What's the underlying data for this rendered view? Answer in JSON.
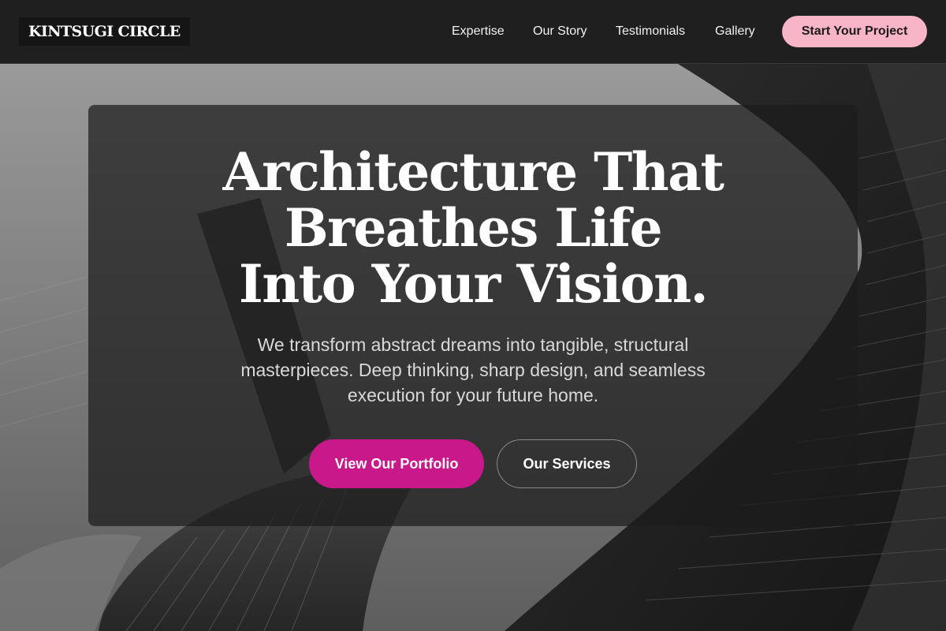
{
  "header": {
    "logo": "KINTSUGI CIRCLE",
    "nav": [
      {
        "label": "Expertise"
      },
      {
        "label": "Our Story"
      },
      {
        "label": "Testimonials"
      },
      {
        "label": "Gallery"
      }
    ],
    "cta_label": "Start Your Project"
  },
  "hero": {
    "title_lines": [
      "Architecture That",
      "Breathes Life",
      "Into Your Vision."
    ],
    "subtitle": "We transform abstract dreams into tangible, structural masterpieces. Deep thinking, sharp design, and seamless execution for your future home.",
    "primary_button": "View Our Portfolio",
    "secondary_button": "Our Services"
  },
  "colors": {
    "header_bg": "#1f1f1f",
    "cta_pink": "#f8b5c8",
    "primary_magenta": "#c8188a",
    "card_bg": "#1c1c1c"
  }
}
